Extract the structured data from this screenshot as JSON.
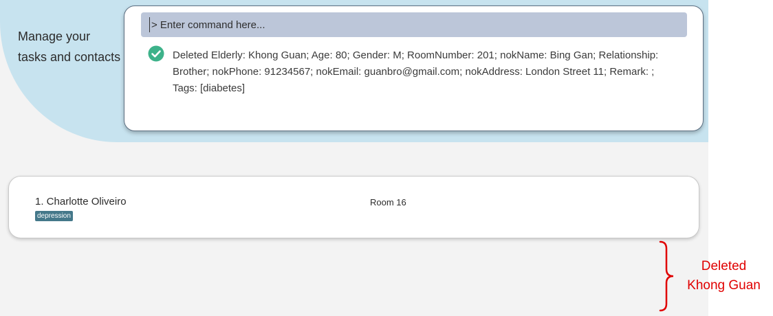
{
  "hero": {
    "tagline": "Manage your tasks and contacts"
  },
  "command_box": {
    "placeholder": "> Enter command here...",
    "result_icon": "check-circle-icon",
    "result_text": "Deleted Elderly: Khong Guan; Age: 80; Gender: M; RoomNumber: 201; nokName: Bing Gan; Relationship: Brother; nokPhone: 91234567; nokEmail: guanbro@gmail.com; nokAddress: London Street 11; Remark: ; Tags: [diabetes]"
  },
  "list": {
    "items": [
      {
        "name": "1. Charlotte Oliveiro",
        "room": "Room 16",
        "tags": [
          "depression"
        ]
      }
    ]
  },
  "annotation": {
    "text": "Deleted Khong Guan",
    "color": "#e00000"
  },
  "colors": {
    "hero_bg": "#c7e3ef",
    "command_input_bg": "#bcc6d9",
    "success_green": "#3db28a",
    "tag_bg": "#44788a"
  }
}
